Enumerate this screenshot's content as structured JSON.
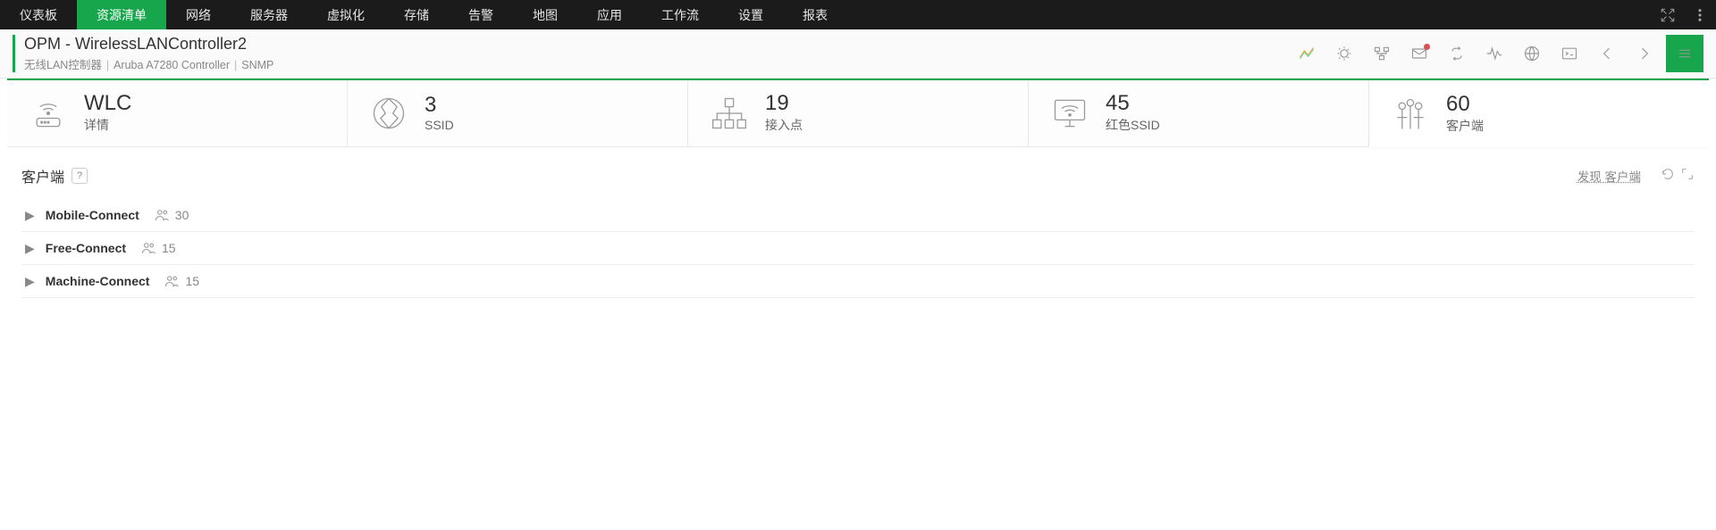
{
  "nav": {
    "items": [
      "仪表板",
      "资源清单",
      "网络",
      "服务器",
      "虚拟化",
      "存储",
      "告警",
      "地图",
      "应用",
      "工作流",
      "设置",
      "报表"
    ],
    "active_index": 1
  },
  "header": {
    "title": "OPM - WirelessLANController2",
    "sub": {
      "controller_type": "无线LAN控制器",
      "product": "Aruba A7280 Controller",
      "protocol": "SNMP"
    }
  },
  "cards": [
    {
      "value": "WLC",
      "label": "详情",
      "icon": "wlc"
    },
    {
      "value": "3",
      "label": "SSID",
      "icon": "ssid"
    },
    {
      "value": "19",
      "label": "接入点",
      "icon": "ap"
    },
    {
      "value": "45",
      "label": "红色SSID",
      "icon": "rssid"
    },
    {
      "value": "60",
      "label": "客户端",
      "icon": "clients"
    }
  ],
  "active_card_index": 4,
  "panel": {
    "title": "客户端",
    "discover": "发现 客户端"
  },
  "rows": [
    {
      "name": "Mobile-Connect",
      "count": "30"
    },
    {
      "name": "Free-Connect",
      "count": "15"
    },
    {
      "name": "Machine-Connect",
      "count": "15"
    }
  ]
}
